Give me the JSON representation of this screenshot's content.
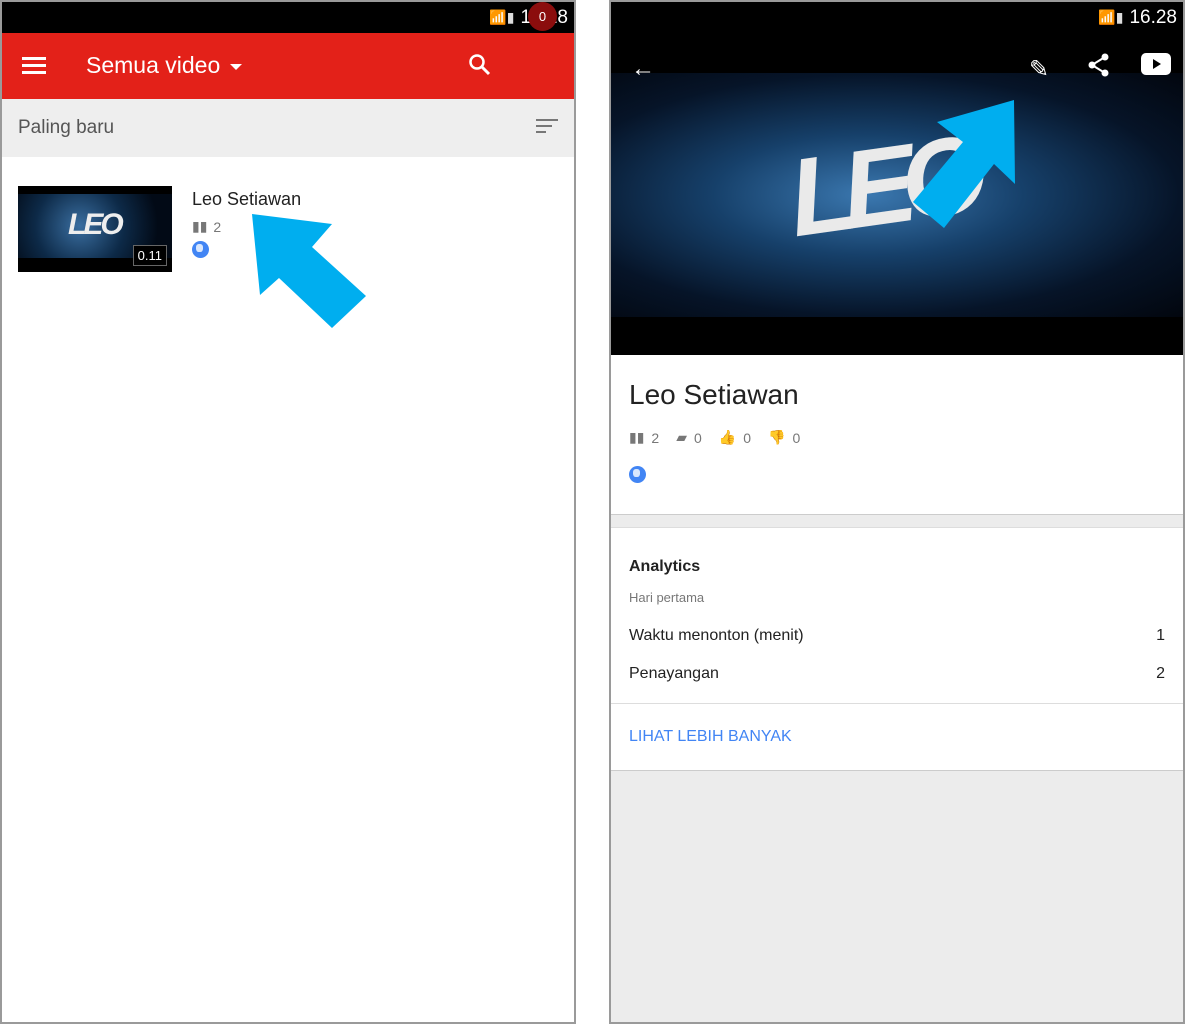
{
  "status": {
    "time": "16.28"
  },
  "left": {
    "toolbar": {
      "title": "Semua video",
      "notification_count": "0"
    },
    "filter": {
      "label": "Paling baru"
    },
    "video": {
      "title": "Leo Setiawan",
      "duration": "0.11",
      "views": "2",
      "thumb_text": "LEO"
    }
  },
  "right": {
    "video": {
      "title": "Leo Setiawan",
      "views": "2",
      "comments": "0",
      "likes": "0",
      "dislikes": "0",
      "thumb_text": "LEO"
    },
    "analytics": {
      "title": "Analytics",
      "period": "Hari pertama",
      "rows": [
        {
          "label": "Waktu menonton (menit)",
          "value": "1"
        },
        {
          "label": "Penayangan",
          "value": "2"
        }
      ],
      "more": "LIHAT LEBIH BANYAK"
    }
  },
  "colors": {
    "toolbar": "#e32119",
    "arrow": "#00aeef",
    "link": "#4285f4"
  }
}
